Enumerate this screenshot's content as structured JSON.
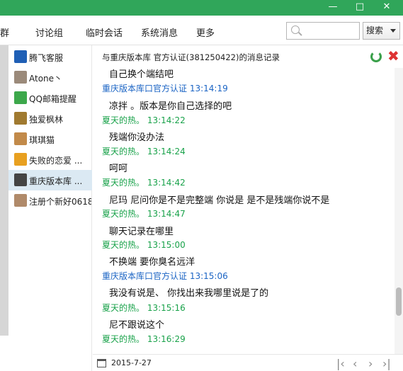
{
  "tabs": [
    "群",
    "讨论组",
    "临时会话",
    "系统消息",
    "更多"
  ],
  "search": {
    "placeholder": "",
    "button_label": "搜索"
  },
  "contacts": [
    {
      "name": "腾飞客服",
      "color": "#1f5fb5"
    },
    {
      "name": "Atone丶",
      "color": "#9b8a7a"
    },
    {
      "name": "QQ邮箱提醒",
      "color": "#3da84b"
    },
    {
      "name": "独爱枫林",
      "color": "#a07a30"
    },
    {
      "name": "琪琪猫",
      "color": "#c28a4a"
    },
    {
      "name": "失败的恋爱 ...",
      "color": "#e8a020"
    },
    {
      "name": "重庆版本库 ...",
      "color": "#444444"
    },
    {
      "name": "注册个新好0618",
      "color": "#b08a6a"
    }
  ],
  "header": {
    "title": "与重庆版本库  官方认证(381250422)的消息记录"
  },
  "messages": [
    {
      "kind": "text",
      "text": "自己换个端结吧"
    },
    {
      "kind": "sender",
      "who": "them",
      "text": "重庆版本库口官方认证  13:14:19"
    },
    {
      "kind": "text",
      "text": "凉拌 。版本是你自己选择的吧"
    },
    {
      "kind": "sender",
      "who": "me",
      "text": "夏天的热。  13:14:22"
    },
    {
      "kind": "text",
      "text": "残端你没办法"
    },
    {
      "kind": "sender",
      "who": "me",
      "text": "夏天的热。  13:14:24"
    },
    {
      "kind": "text",
      "text": "呵呵"
    },
    {
      "kind": "sender",
      "who": "me",
      "text": "夏天的热。  13:14:42"
    },
    {
      "kind": "text",
      "text": "尼玛 尼问你是不是完整端  你说是  是不是残端你说不是"
    },
    {
      "kind": "sender",
      "who": "me",
      "text": "夏天的热。  13:14:47"
    },
    {
      "kind": "text",
      "text": "聊天记录在哪里"
    },
    {
      "kind": "sender",
      "who": "me",
      "text": "夏天的热。  13:15:00"
    },
    {
      "kind": "text",
      "text": "不换端  要你臭名远洋"
    },
    {
      "kind": "sender",
      "who": "them",
      "text": "重庆版本库口官方认证  13:15:06"
    },
    {
      "kind": "text",
      "text": "我没有说是、 你找出来我哪里说是了的"
    },
    {
      "kind": "sender",
      "who": "me",
      "text": "夏天的热。  13:15:16"
    },
    {
      "kind": "text",
      "text": "尼不跟说这个"
    },
    {
      "kind": "sender",
      "who": "me",
      "text": "夏天的热。  13:16:29"
    }
  ],
  "footer": {
    "date": "2015-7-27"
  },
  "colors": {
    "accent": "#30a65a",
    "sender_me": "#19a24a",
    "sender_them": "#1b64c4",
    "active_contact": "#dbe9f3"
  }
}
